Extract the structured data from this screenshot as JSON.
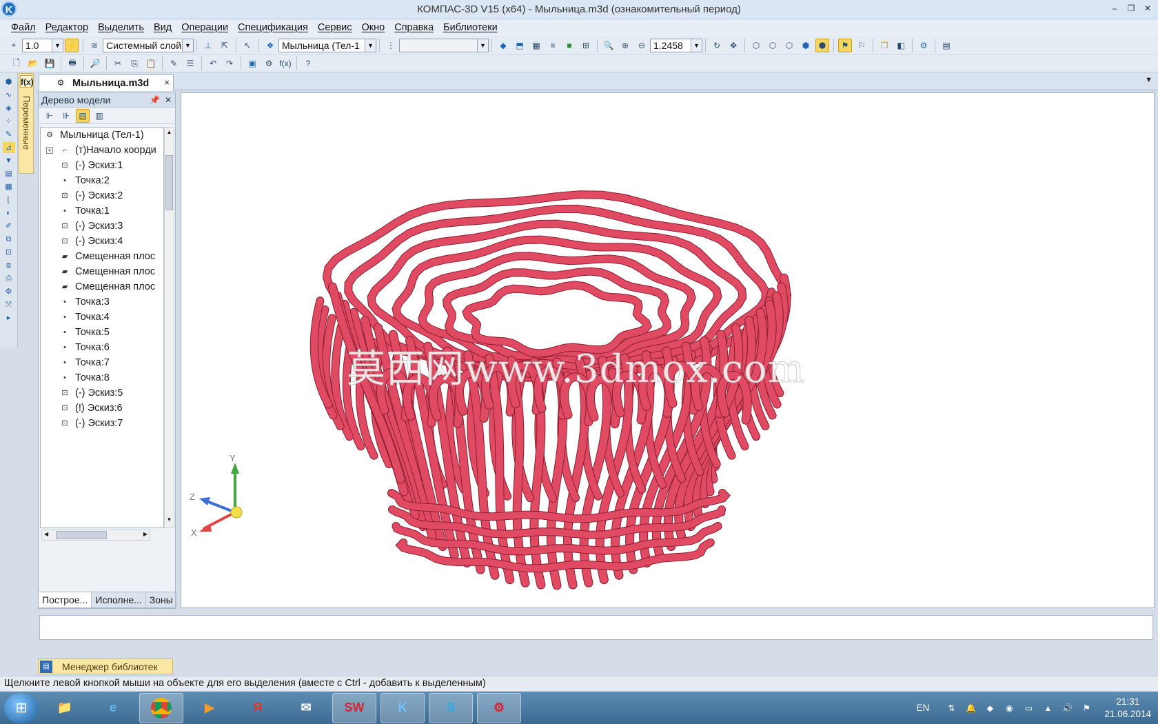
{
  "window": {
    "title": "КОМПАС-3D V15 (x64) - Мыльница.m3d (ознакомительный период)",
    "controls": {
      "minimize": "–",
      "restore": "❐",
      "close": "✕"
    }
  },
  "menu": [
    "Файл",
    "Редактор",
    "Выделить",
    "Вид",
    "Операции",
    "Спецификация",
    "Сервис",
    "Окно",
    "Справка",
    "Библиотеки"
  ],
  "toolbar1": {
    "step_value": "1.0",
    "layer_value": "Системный слой",
    "body_value": "Мыльница (Тел-1",
    "empty_combo_value": "",
    "zoom_value": "1.2458"
  },
  "left_panel": {
    "variables_tab_label": "Переменные",
    "fx_label": "f(x)"
  },
  "document_tab": {
    "label": "Мыльница.m3d",
    "close": "×"
  },
  "model_tree": {
    "title": "Дерево модели",
    "items": [
      {
        "label": "Мыльница (Тел-1)",
        "icon": "part-icon"
      },
      {
        "label": "(т)Начало коорди",
        "icon": "origin-icon",
        "expandable": true
      },
      {
        "label": "(-) Эскиз:1",
        "icon": "sketch-icon"
      },
      {
        "label": "Точка:2",
        "icon": "point-icon"
      },
      {
        "label": "(-) Эскиз:2",
        "icon": "sketch-icon"
      },
      {
        "label": "Точка:1",
        "icon": "point-icon"
      },
      {
        "label": "(-) Эскиз:3",
        "icon": "sketch-icon"
      },
      {
        "label": "(-) Эскиз:4",
        "icon": "sketch-icon"
      },
      {
        "label": "Смещенная плос",
        "icon": "plane-icon"
      },
      {
        "label": "Смещенная плос",
        "icon": "plane-icon"
      },
      {
        "label": "Смещенная плос",
        "icon": "plane-icon"
      },
      {
        "label": "Точка:3",
        "icon": "point-icon"
      },
      {
        "label": "Точка:4",
        "icon": "point-icon"
      },
      {
        "label": "Точка:5",
        "icon": "point-icon"
      },
      {
        "label": "Точка:6",
        "icon": "point-icon"
      },
      {
        "label": "Точка:7",
        "icon": "point-icon"
      },
      {
        "label": "Точка:8",
        "icon": "point-icon"
      },
      {
        "label": "(-) Эскиз:5",
        "icon": "sketch-icon"
      },
      {
        "label": "(!) Эскиз:6",
        "icon": "sketch-icon"
      },
      {
        "label": "(-) Эскиз:7",
        "icon": "sketch-icon"
      }
    ],
    "tabs": [
      "Построе...",
      "Исполне...",
      "Зоны"
    ]
  },
  "viewport": {
    "watermark": "莫西网www.3dmox.com",
    "model_color": "#e04a62",
    "axes": {
      "x": "X",
      "y": "Y",
      "z": "Z"
    }
  },
  "library_manager": {
    "label": "Менеджер библиотек"
  },
  "status_bar": {
    "text": "Щелкните левой кнопкой мыши на объекте для его выделения (вместе с Ctrl - добавить к выделенным)"
  },
  "taskbar": {
    "apps": [
      "explorer-icon",
      "ie-icon",
      "chrome-icon",
      "media-icon",
      "yandex-icon",
      "mail-icon",
      "solidworks-icon",
      "kompas-icon",
      "skype-icon",
      "solidworks2-icon"
    ],
    "language": "EN",
    "time": "21:31",
    "date": "21.06.2014"
  }
}
